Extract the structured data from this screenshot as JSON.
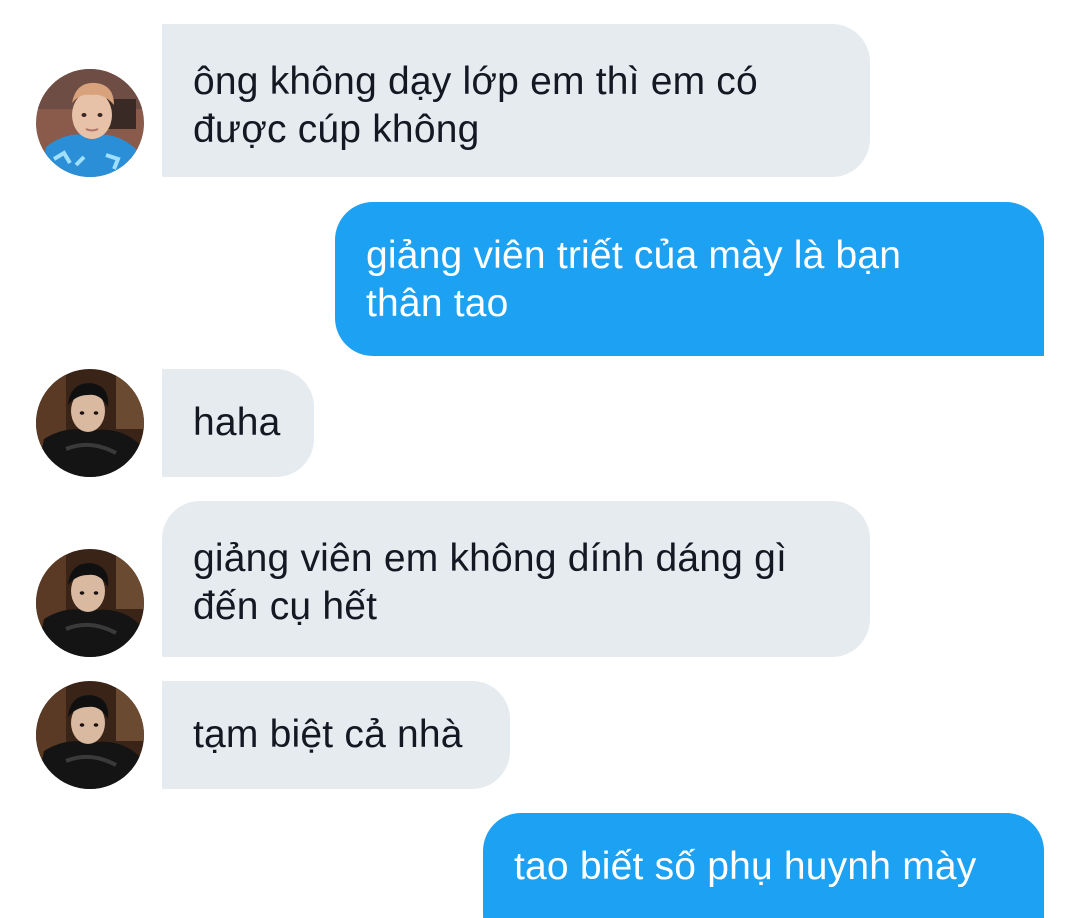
{
  "conversation": {
    "messages": [
      {
        "direction": "incoming",
        "avatar": "avatar-1",
        "lines": [
          "ông không dạy lớp em thì em có",
          "được cúp không"
        ]
      },
      {
        "direction": "outgoing",
        "lines": [
          "giảng viên triết của mày là bạn",
          "thân tao"
        ]
      },
      {
        "direction": "incoming",
        "avatar": "avatar-2",
        "lines": [
          "haha"
        ]
      },
      {
        "direction": "incoming",
        "avatar": "avatar-2",
        "lines": [
          "giảng viên em không dính dáng gì",
          "đến cụ hết"
        ]
      },
      {
        "direction": "incoming",
        "avatar": "avatar-2",
        "lines": [
          "tạm biệt cả nhà"
        ]
      },
      {
        "direction": "outgoing",
        "lines": [
          "tao biết số phụ huynh mày"
        ]
      }
    ]
  },
  "colors": {
    "background": "#ffffff",
    "incoming_bubble": "#e6ebf0",
    "incoming_text": "#141823",
    "outgoing_bubble": "#1da1f2",
    "outgoing_text": "#ffffff"
  },
  "icons": {
    "avatar-1": "person-photo-blue-shirt",
    "avatar-2": "person-photo-black-leather-jacket"
  }
}
